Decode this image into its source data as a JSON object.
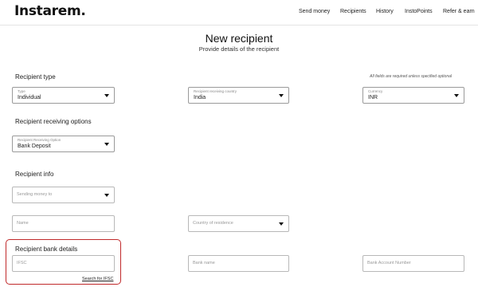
{
  "header": {
    "logo": "Instarem.",
    "nav": [
      "Send money",
      "Recipients",
      "History",
      "InstoPoints",
      "Refer & earn"
    ]
  },
  "page": {
    "title": "New recipient",
    "subtitle": "Provide details of the recipient"
  },
  "recipient_type": {
    "title": "Recipient type",
    "note": "All fields are required unless specified optional",
    "type": {
      "label": "Type",
      "value": "Individual"
    },
    "country": {
      "label": "Recipient receiving country",
      "value": "India"
    },
    "currency": {
      "label": "Currency",
      "value": "INR"
    }
  },
  "receiving_options": {
    "title": "Recipient receiving options",
    "option": {
      "label": "Recipient Receiving Option",
      "value": "Bank Deposit"
    }
  },
  "recipient_info": {
    "title": "Recipient info",
    "sending_money_to": {
      "placeholder": "Sending money to"
    },
    "name": {
      "placeholder": "Name"
    },
    "country_of_residence": {
      "placeholder": "Country of residence"
    }
  },
  "bank_details": {
    "title": "Recipient bank details",
    "ifsc": {
      "placeholder": "IFSC"
    },
    "bank_name": {
      "placeholder": "Bank name"
    },
    "account_number": {
      "placeholder": "Bank Account Number"
    },
    "search_ifsc": "Search for IFSC"
  }
}
